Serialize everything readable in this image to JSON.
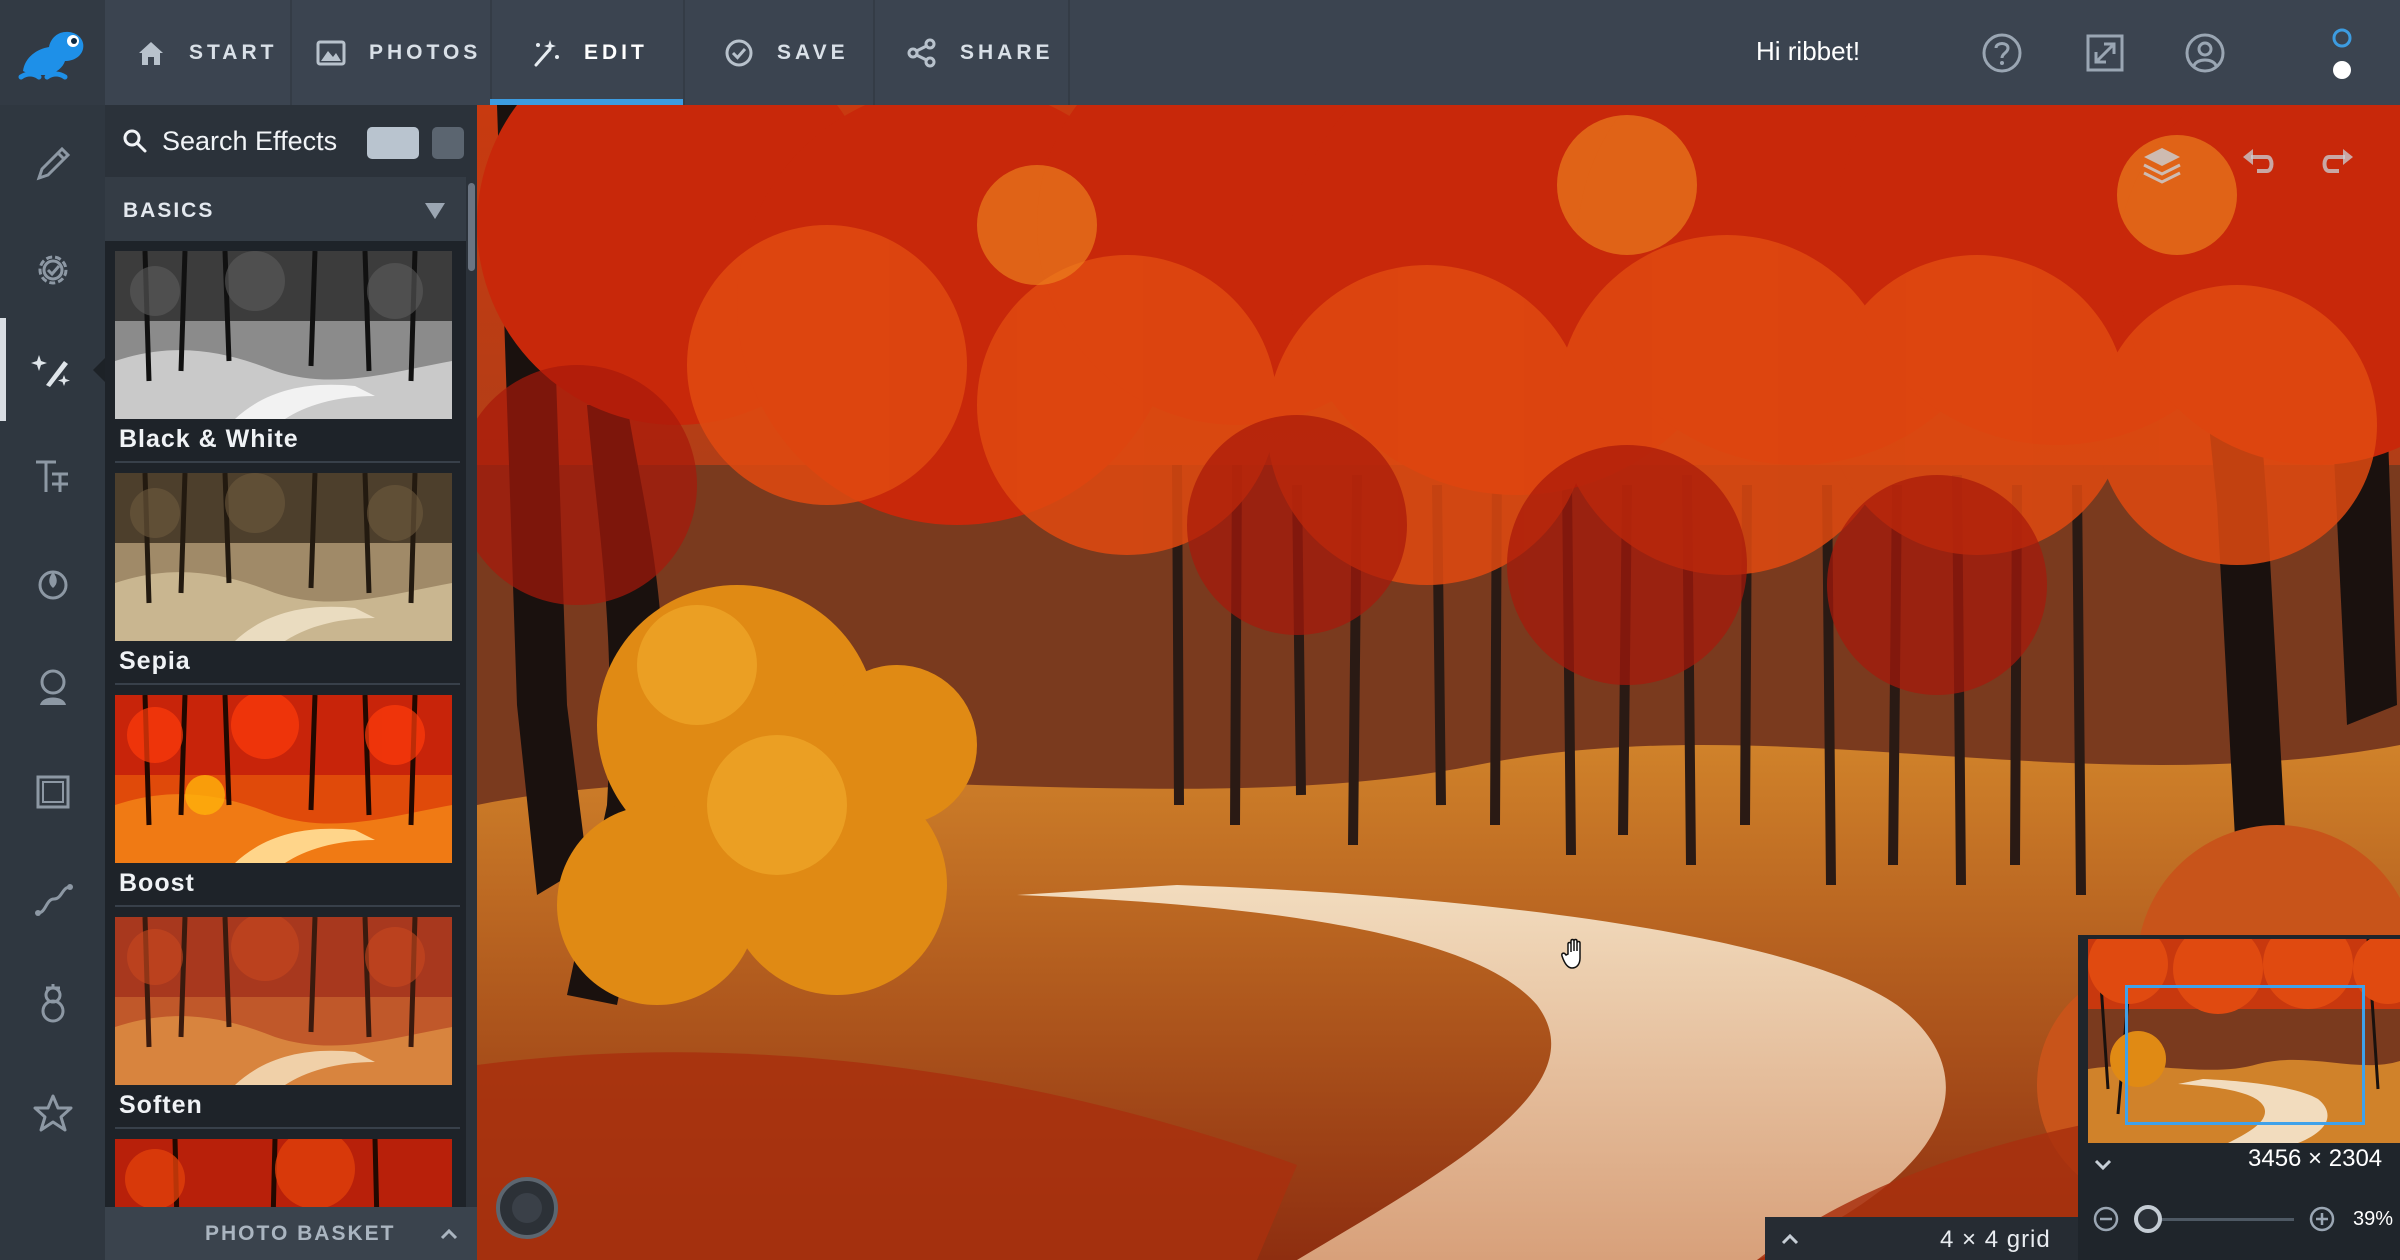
{
  "topbar": {
    "tabs": [
      {
        "id": "start",
        "label": "START",
        "icon": "home-icon"
      },
      {
        "id": "photos",
        "label": "PHOTOS",
        "icon": "photo-icon"
      },
      {
        "id": "edit",
        "label": "EDIT",
        "icon": "magic-wand-icon",
        "active": true
      },
      {
        "id": "save",
        "label": "SAVE",
        "icon": "checkmark-circle-icon"
      },
      {
        "id": "share",
        "label": "SHARE",
        "icon": "share-icon"
      }
    ],
    "greeting": "Hi ribbet!",
    "right_icons": [
      "help-icon",
      "fullscreen-icon",
      "account-icon",
      "theme-toggle-icon"
    ]
  },
  "rail": {
    "tools": [
      "pencil-icon",
      "gear-icon",
      "effects-icon",
      "text-icon",
      "color-icon",
      "touch-up-icon",
      "frame-icon",
      "curve-icon",
      "seasonal-icon",
      "favorites-icon"
    ],
    "active_tool": "effects-icon"
  },
  "effects_panel": {
    "search_placeholder": "Search Effects",
    "category": "BASICS",
    "effects": [
      {
        "label": "Black & White"
      },
      {
        "label": "Sepia"
      },
      {
        "label": "Boost"
      },
      {
        "label": "Soften"
      }
    ],
    "basket_label": "PHOTO BASKET"
  },
  "canvas": {
    "grid_label": "4 × 4  grid",
    "tool_icons": [
      "layers-icon",
      "undo-icon",
      "redo-icon"
    ]
  },
  "navigator": {
    "dimensions": "3456 × 2304",
    "zoom": "39%",
    "zoom_fraction": 0.39
  },
  "colors": {
    "accent": "#3d9ce0",
    "topbar": "#3b4450",
    "panel": "#1e2329"
  }
}
